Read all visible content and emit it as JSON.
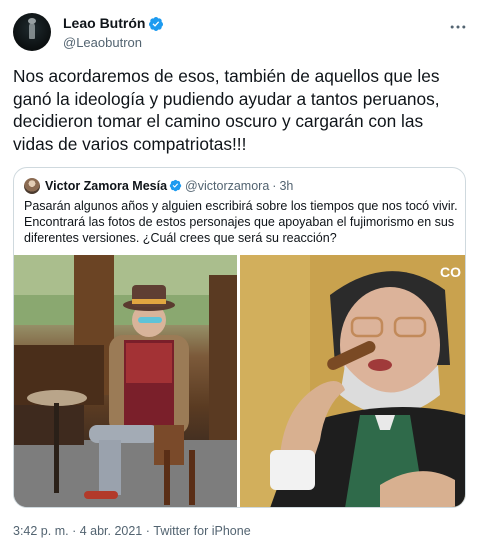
{
  "tweet": {
    "author": {
      "display_name": "Leao Butrón",
      "handle": "@Leaobutron",
      "verified_icon": "verified-badge-icon"
    },
    "more_icon": "more-options-icon",
    "text": "Nos acordaremos de esos, también de aquellos que les ganó la ideología y pudiendo ayudar a tantos peruanos, decidieron tomar  el camino oscuro y cargarán con las vidas de varios compatriotas!!!",
    "quoted": {
      "display_name": "Victor Zamora Mesía",
      "handle": "@victorzamora",
      "separator": "·",
      "time": "3h",
      "text": "Pasarán algunos años y alguien escribirá sobre los tiempos que nos tocó vivir. Encontrará las fotos de estos personajes que apoyaban el fujimorismo en sus diferentes versiones. ¿Cuál crees que será su reacción?",
      "images": [
        {
          "icon": "photo-man-in-hat-seated"
        },
        {
          "icon": "photo-man-with-cigar"
        }
      ]
    },
    "footer": {
      "time": "3:42 p. m.",
      "separator1": " · ",
      "date": "4 abr. 2021",
      "separator2": " · ",
      "source": "Twitter for iPhone"
    },
    "colors": {
      "verified": "#1d9bf0",
      "secondary_text": "#536471",
      "border": "#cfd9de"
    }
  }
}
